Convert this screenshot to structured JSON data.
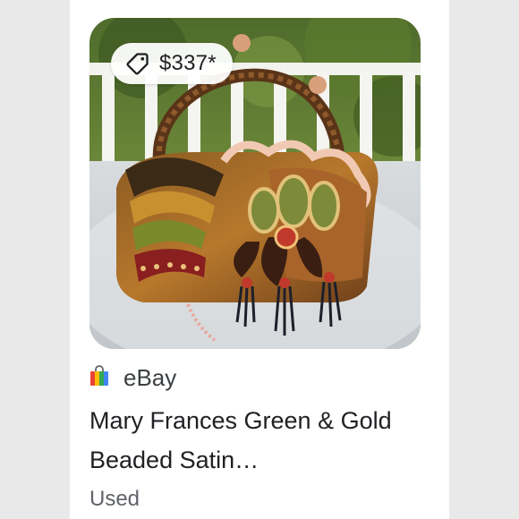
{
  "product": {
    "price": "$337*",
    "source": "eBay",
    "title": "Mary Frances Green & Gold Beaded Satin…",
    "condition": "Used"
  },
  "icons": {
    "price_tag": "price-tag-icon",
    "shopping_bag": "shopping-bag-icon"
  },
  "colors": {
    "badge_bg": "#ffffff",
    "title_text": "#202124",
    "secondary_text": "#5f6368"
  }
}
